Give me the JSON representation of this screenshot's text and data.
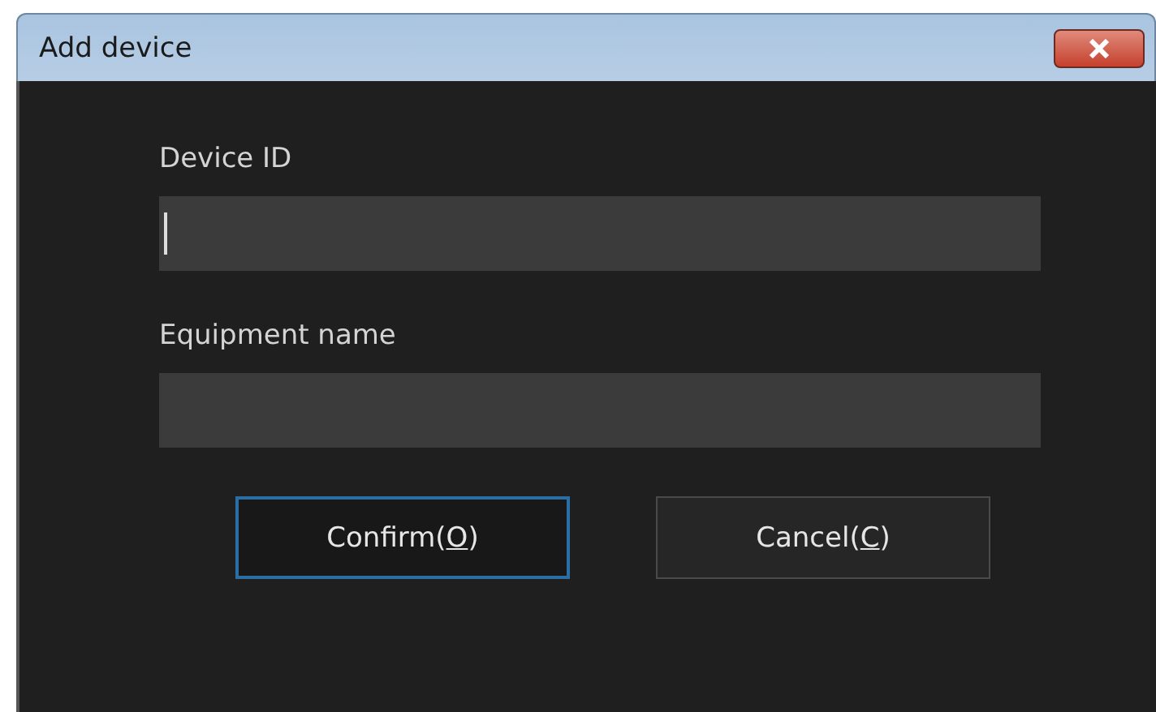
{
  "window": {
    "title": "Add device"
  },
  "fields": [
    {
      "label": "Device ID",
      "focused": true
    },
    {
      "label": "Equipment name",
      "focused": false
    }
  ],
  "buttons": [
    {
      "label": "Confirm(",
      "access_key": "O",
      "label_end": ")",
      "focused": true
    },
    {
      "label": "Cancel(",
      "access_key": "C",
      "label_end": ")",
      "focused": false
    }
  ]
}
